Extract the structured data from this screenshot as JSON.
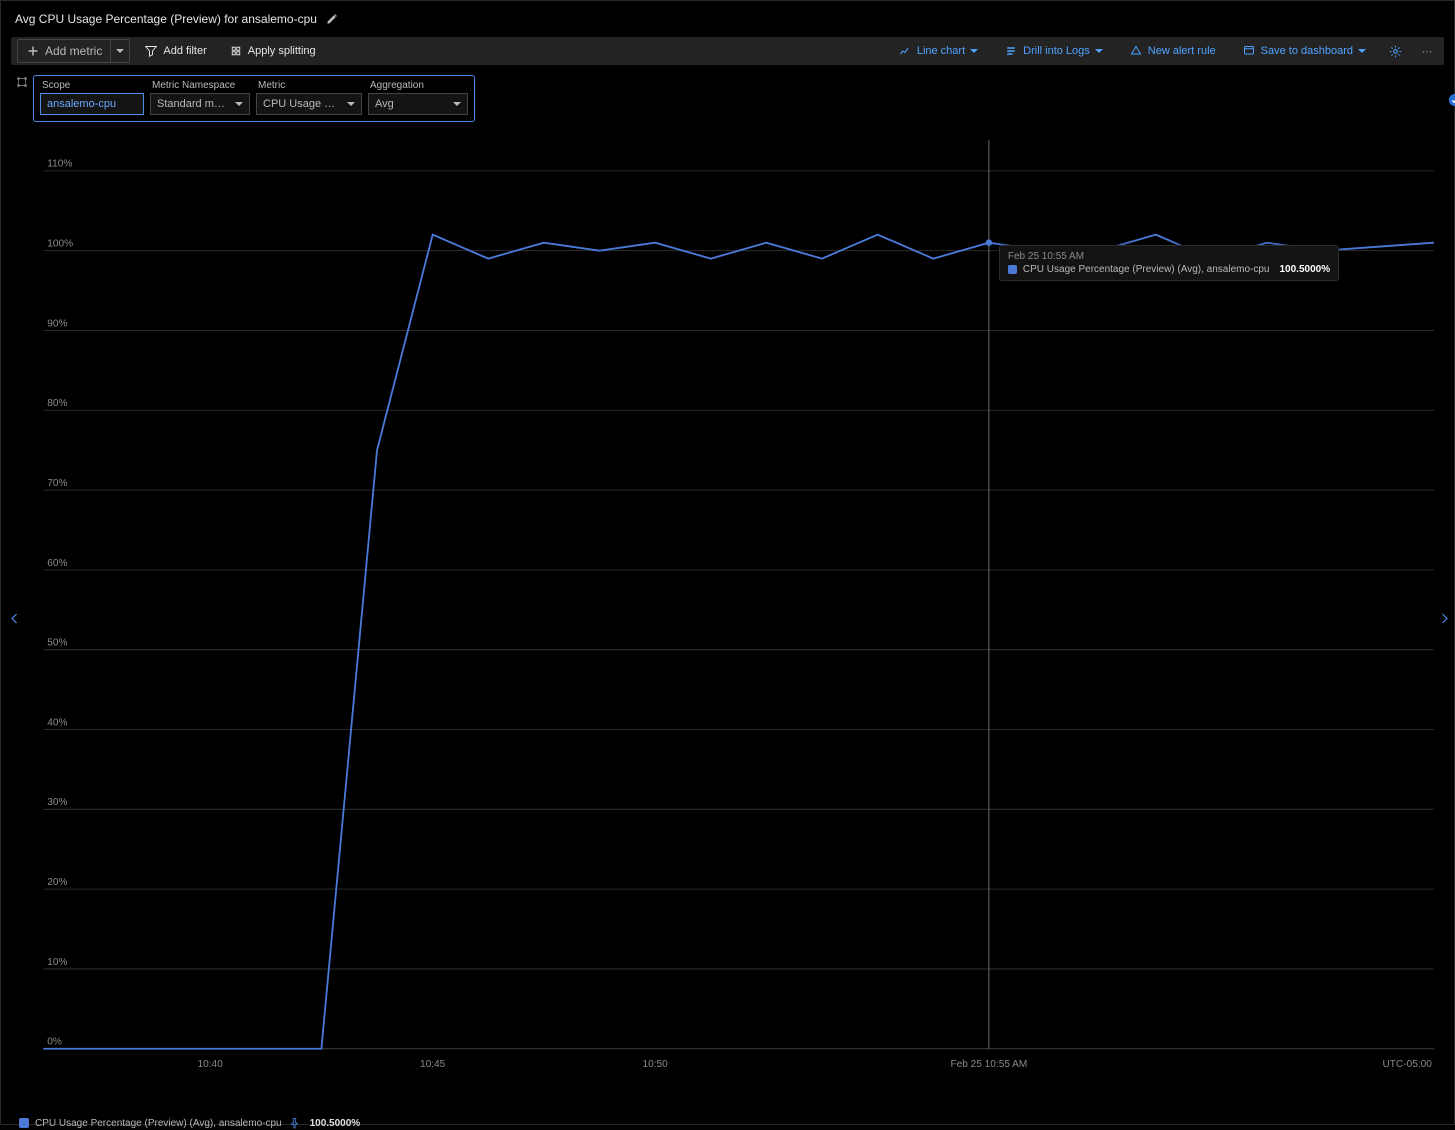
{
  "header": {
    "title": "Avg CPU Usage Percentage (Preview) for ansalemo-cpu"
  },
  "toolbar": {
    "add_metric": "Add metric",
    "add_filter": "Add filter",
    "apply_splitting": "Apply splitting",
    "chart_type": "Line chart",
    "drill_logs": "Drill into Logs",
    "new_alert": "New alert rule",
    "save_dashboard": "Save to dashboard"
  },
  "scope": {
    "labels": {
      "scope": "Scope",
      "namespace": "Metric Namespace",
      "metric": "Metric",
      "aggregation": "Aggregation"
    },
    "values": {
      "scope": "ansalemo-cpu",
      "namespace": "Standard metrics",
      "metric": "CPU Usage Percentag…",
      "aggregation": "Avg"
    }
  },
  "tooltip": {
    "time": "Feb 25 10:55 AM",
    "series": "CPU Usage Percentage (Preview) (Avg), ansalemo-cpu",
    "value": "100.5000%"
  },
  "legend": {
    "series": "CPU Usage Percentage (Preview) (Avg), ansalemo-cpu",
    "value": "100.5000%"
  },
  "x_hover_label": "Feb 25 10:55 AM",
  "x_ticks": [
    "10:40",
    "10:45",
    "10:50"
  ],
  "utc_label": "UTC-05:00",
  "chart_data": {
    "type": "line",
    "title": "Avg CPU Usage Percentage (Preview) for ansalemo-cpu",
    "xlabel": "",
    "ylabel": "",
    "ylim": [
      0,
      110
    ],
    "y_ticks": [
      0,
      10,
      20,
      30,
      40,
      50,
      60,
      70,
      80,
      90,
      100,
      110
    ],
    "y_tick_labels": [
      "0%",
      "10%",
      "20%",
      "30%",
      "40%",
      "50%",
      "60%",
      "70%",
      "80%",
      "90%",
      "100%",
      "110%"
    ],
    "x": [
      0,
      1,
      2,
      3,
      4,
      5,
      6,
      7,
      8,
      9,
      10,
      11,
      12,
      13,
      14,
      15,
      16,
      17,
      18,
      19,
      20,
      21,
      22,
      23,
      24,
      25
    ],
    "x_label_ticks": {
      "3": "10:40",
      "7": "10:45",
      "11": "10:50",
      "17": "Feb 25 10:55 AM"
    },
    "series": [
      {
        "name": "CPU Usage Percentage (Preview) (Avg), ansalemo-cpu",
        "values": [
          0,
          0,
          0,
          0,
          0,
          0,
          75,
          102,
          99,
          101,
          100,
          101,
          99,
          101,
          99,
          102,
          99,
          101,
          100,
          100,
          102,
          99,
          101,
          100,
          100.5,
          101
        ]
      }
    ],
    "hover_index": 17
  }
}
